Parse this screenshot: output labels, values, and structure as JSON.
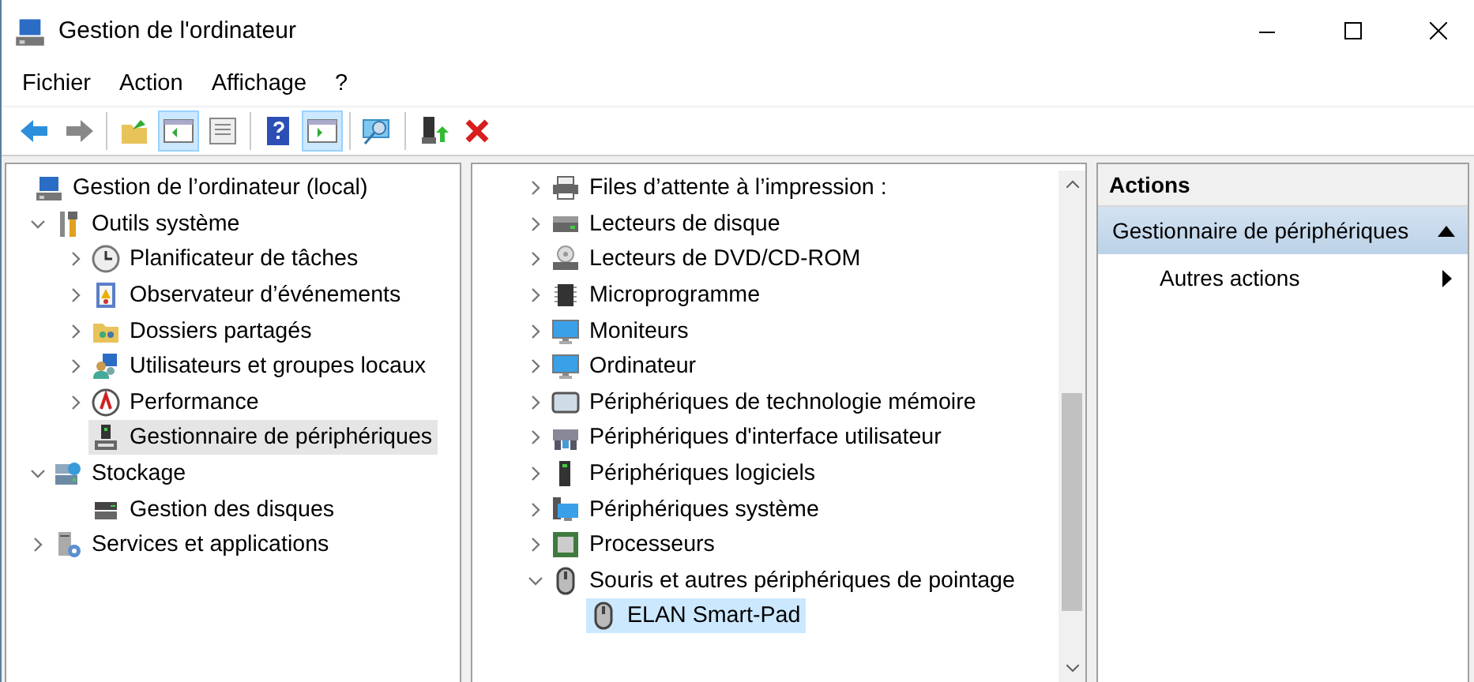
{
  "window": {
    "title": "Gestion de l'ordinateur"
  },
  "menu": [
    {
      "label": "Fichier"
    },
    {
      "label": "Action"
    },
    {
      "label": "Affichage"
    },
    {
      "label": "?"
    }
  ],
  "toolbar": [
    [
      {
        "disabled": false,
        "pressed": false
      },
      {
        "disabled": true,
        "pressed": false
      }
    ],
    [
      {
        "pressed": false
      },
      {
        "pressed": true
      },
      {
        "pressed": false
      }
    ],
    [
      {
        "pressed": false
      },
      {
        "pressed": true
      }
    ],
    [
      {
        "pressed": false
      }
    ],
    [
      {
        "pressed": false
      },
      {
        "pressed": false
      }
    ]
  ],
  "console_tree": [
    {
      "label": "Gestion de l’ordinateur (local)",
      "selected": false,
      "children": [
        {
          "label": "Outils système",
          "expanded": true,
          "selected": false,
          "children": [
            {
              "label": "Planificateur de tâches",
              "expanded": false,
              "selected": false
            },
            {
              "label": "Observateur d’événements",
              "expanded": false,
              "selected": false
            },
            {
              "label": "Dossiers partagés",
              "expanded": false,
              "selected": false
            },
            {
              "label": "Utilisateurs et groupes locaux",
              "expanded": false,
              "selected": false
            },
            {
              "label": "Performance",
              "expanded": false,
              "selected": false
            },
            {
              "label": "Gestionnaire de périphériques",
              "selected": true
            }
          ]
        },
        {
          "label": "Stockage",
          "expanded": true,
          "selected": false,
          "children": [
            {
              "label": "Gestion des disques",
              "selected": false
            }
          ]
        },
        {
          "label": "Services et applications",
          "expanded": false,
          "selected": false
        }
      ]
    }
  ],
  "device_tree": [
    {
      "label": "Files d’attente à l’impression :",
      "expanded": false,
      "selected": false
    },
    {
      "label": "Lecteurs de disque",
      "expanded": false,
      "selected": false
    },
    {
      "label": "Lecteurs de DVD/CD-ROM",
      "expanded": false,
      "selected": false
    },
    {
      "label": "Microprogramme",
      "expanded": false,
      "selected": false
    },
    {
      "label": "Moniteurs",
      "expanded": false,
      "selected": false
    },
    {
      "label": "Ordinateur",
      "expanded": false,
      "selected": false
    },
    {
      "label": "Périphériques de technologie mémoire",
      "expanded": false,
      "selected": false
    },
    {
      "label": "Périphériques d'interface utilisateur",
      "expanded": false,
      "selected": false
    },
    {
      "label": "Périphériques logiciels",
      "expanded": false,
      "selected": false
    },
    {
      "label": "Périphériques système",
      "expanded": false,
      "selected": false
    },
    {
      "label": "Processeurs",
      "expanded": false,
      "selected": false
    },
    {
      "label": "Souris et autres périphériques de pointage",
      "expanded": true,
      "selected": false,
      "children": [
        {
          "label": "ELAN Smart-Pad",
          "selected": true
        }
      ]
    }
  ],
  "actions": {
    "title": "Actions",
    "sections": [
      {
        "label": "Gestionnaire de périphériques",
        "expanded": true,
        "items": [
          {
            "label": "Autres actions"
          }
        ]
      }
    ]
  }
}
